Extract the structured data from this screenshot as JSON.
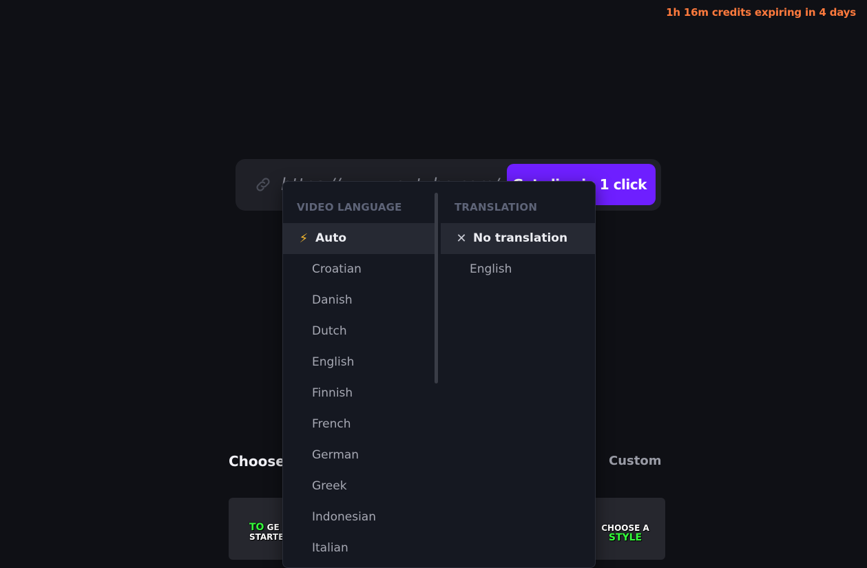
{
  "header": {
    "credits_text": "1h 16m credits expiring in 4 days"
  },
  "url_bar": {
    "placeholder": "https://www.youtube.com/",
    "link_icon": "link-icon",
    "cta_label": "Get clips in 1 click"
  },
  "dropdown": {
    "language": {
      "header": "VIDEO LANGUAGE",
      "selected_icon": "⚡",
      "options": [
        "Auto",
        "Croatian",
        "Danish",
        "Dutch",
        "English",
        "Finnish",
        "French",
        "German",
        "Greek",
        "Indonesian",
        "Italian"
      ]
    },
    "translation": {
      "header": "TRANSLATION",
      "selected_icon": "✕",
      "options": [
        "No translation",
        "English"
      ]
    }
  },
  "styles": {
    "title": "Choose",
    "custom_tab": "Custom",
    "left_card": {
      "line1_green": "TO",
      "line1_white": " GE",
      "line2": "STARTE"
    },
    "right_card": {
      "line1": "CHOOSE A",
      "line2_green": "STYLE"
    }
  },
  "colors": {
    "background": "#0f1015",
    "accent": "#6e1fff",
    "credits": "#ff7a3d",
    "caption_green": "#34ff3a"
  }
}
